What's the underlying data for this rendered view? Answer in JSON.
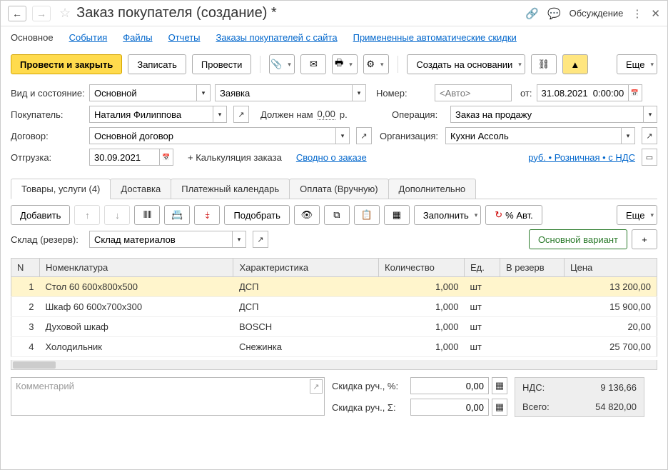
{
  "title": "Заказ покупателя (создание) *",
  "titlebar_right": {
    "discuss": "Обсуждение"
  },
  "nav": {
    "main": "Основное",
    "events": "События",
    "files": "Файлы",
    "reports": "Отчеты",
    "site_orders": "Заказы покупателей с сайта",
    "auto_discounts": "Примененные автоматические скидки"
  },
  "toolbar": {
    "post_close": "Провести и закрыть",
    "save": "Записать",
    "post": "Провести",
    "create_based": "Создать на основании",
    "more": "Еще"
  },
  "form": {
    "type_state_label": "Вид и состояние:",
    "type": "Основной",
    "state": "Заявка",
    "number_label": "Номер:",
    "number_placeholder": "<Авто>",
    "from_label": "от:",
    "date": "31.08.2021  0:00:00",
    "buyer_label": "Покупатель:",
    "buyer": "Наталия Филиппова",
    "debt_label": "Должен нам",
    "debt_value": "0,00",
    "debt_currency": "р.",
    "operation_label": "Операция:",
    "operation": "Заказ на продажу",
    "contract_label": "Договор:",
    "contract": "Основной договор",
    "org_label": "Организация:",
    "org": "Кухни Ассоль",
    "shipment_label": "Отгрузка:",
    "shipment_date": "30.09.2021",
    "calc_link": "+ Калькуляция заказа",
    "summary_link": "Сводно о заказе",
    "currency_link": "руб. • Розничная • с НДС"
  },
  "tabs": {
    "goods": "Товары, услуги (4)",
    "delivery": "Доставка",
    "pay_calendar": "Платежный календарь",
    "payment": "Оплата (Вручную)",
    "extra": "Дополнительно"
  },
  "subtoolbar": {
    "add": "Добавить",
    "pick": "Подобрать",
    "fill": "Заполнить",
    "auto_pct": "% Авт.",
    "more": "Еще",
    "warehouse_label": "Склад (резерв):",
    "warehouse": "Склад материалов",
    "main_variant": "Основной вариант"
  },
  "grid": {
    "headers": {
      "n": "N",
      "item": "Номенклатура",
      "char": "Характеристика",
      "qty": "Количество",
      "unit": "Ед.",
      "reserve": "В резерв",
      "price": "Цена"
    },
    "rows": [
      {
        "n": "1",
        "item": "Стол 60 600х800х500",
        "char": "ДСП",
        "qty": "1,000",
        "unit": "шт",
        "reserve": "",
        "price": "13 200,00"
      },
      {
        "n": "2",
        "item": "Шкаф 60 600х700х300",
        "char": "ДСП",
        "qty": "1,000",
        "unit": "шт",
        "reserve": "",
        "price": "15 900,00"
      },
      {
        "n": "3",
        "item": "Духовой шкаф",
        "char": "BOSCH",
        "qty": "1,000",
        "unit": "шт",
        "reserve": "",
        "price": "20,00"
      },
      {
        "n": "4",
        "item": "Холодильник",
        "char": "Снежинка",
        "qty": "1,000",
        "unit": "шт",
        "reserve": "",
        "price": "25 700,00"
      }
    ]
  },
  "footer": {
    "comment_placeholder": "Комментарий",
    "discount_pct_label": "Скидка руч., %:",
    "discount_pct": "0,00",
    "discount_sum_label": "Скидка руч., Σ:",
    "discount_sum": "0,00",
    "vat_label": "НДС:",
    "vat": "9 136,66",
    "total_label": "Всего:",
    "total": "54 820,00"
  }
}
